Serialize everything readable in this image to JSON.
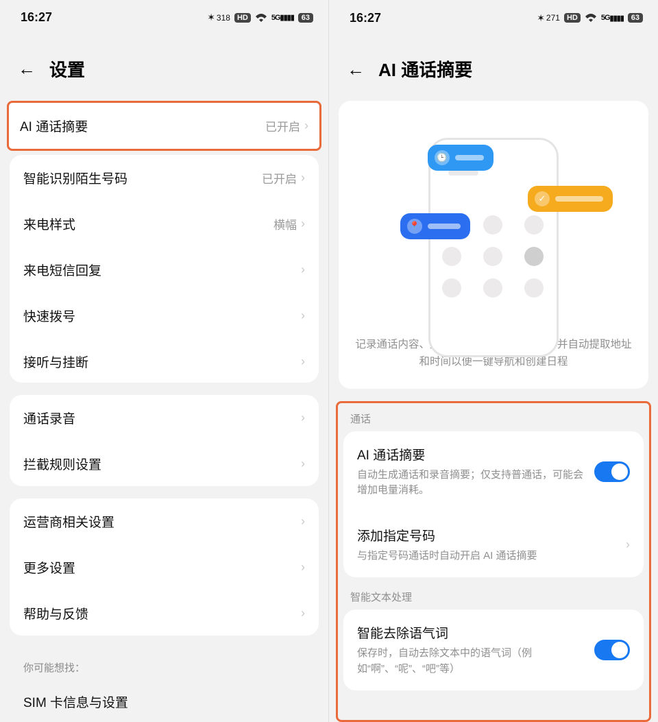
{
  "statusbar": {
    "time": "16:27",
    "bt_speed_left": "318",
    "bt_speed_right": "271",
    "hd": "HD",
    "net": "5G",
    "battery": "63"
  },
  "left": {
    "title": "设置",
    "rows": {
      "ai_summary": {
        "label": "AI 通话摘要",
        "value": "已开启"
      },
      "id_unknown": {
        "label": "智能识别陌生号码",
        "value": "已开启"
      },
      "incoming_style": {
        "label": "来电样式",
        "value": "横幅"
      },
      "sms_reply": {
        "label": "来电短信回复"
      },
      "speed_dial": {
        "label": "快速拨号"
      },
      "answer_hangup": {
        "label": "接听与挂断"
      },
      "call_record": {
        "label": "通话录音"
      },
      "block_rules": {
        "label": "拦截规则设置"
      },
      "carrier": {
        "label": "运营商相关设置"
      },
      "more": {
        "label": "更多设置"
      },
      "help": {
        "label": "帮助与反馈"
      }
    },
    "suggest_header": "你可能想找：",
    "suggest_item": "SIM 卡信息与设置"
  },
  "right": {
    "title": "AI 通话摘要",
    "illus_desc": "记录通话内容、生成通话摘要和核心事项，并自动提取地址和时间以便一键导航和创建日程",
    "section_call": "通话",
    "ai_row": {
      "title": "AI 通话摘要",
      "sub": "自动生成通话和录音摘要；仅支持普通话，可能会增加电量消耗。"
    },
    "add_row": {
      "title": "添加指定号码",
      "sub": "与指定号码通话时自动开启 AI 通话摘要"
    },
    "section_text": "智能文本处理",
    "filler_row": {
      "title": "智能去除语气词",
      "sub": "保存时，自动去除文本中的语气词（例如“啊”、“呢”、“吧”等）"
    }
  }
}
